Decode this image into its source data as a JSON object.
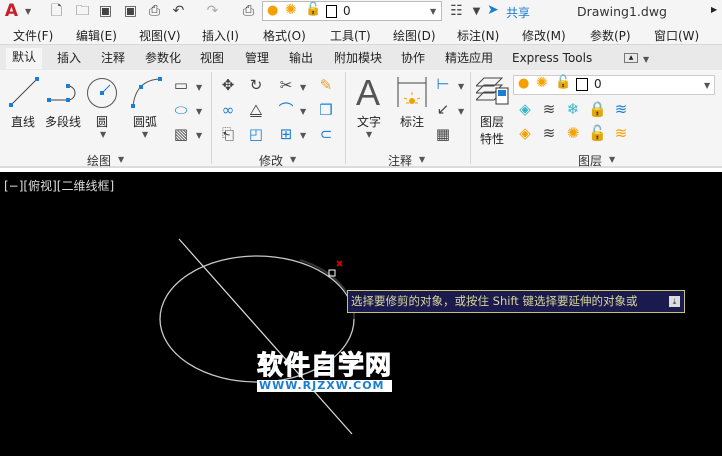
{
  "qat": {
    "app_icon": "A",
    "layer_value": "0",
    "share": "共享",
    "title": "Drawing1.dwg"
  },
  "menus": [
    "文件(F)",
    "编辑(E)",
    "视图(V)",
    "插入(I)",
    "格式(O)",
    "工具(T)",
    "绘图(D)",
    "标注(N)",
    "修改(M)",
    "参数(P)",
    "窗口(W)"
  ],
  "tabs": [
    "默认",
    "插入",
    "注释",
    "参数化",
    "视图",
    "管理",
    "输出",
    "附加模块",
    "协作",
    "精选应用",
    "Express Tools"
  ],
  "ribbon": {
    "draw": {
      "line": "直线",
      "polyline": "多段线",
      "circle": "圆",
      "arc": "圆弧",
      "panel": "绘图"
    },
    "modify": {
      "panel": "修改"
    },
    "annotation": {
      "text": "文字",
      "dimension": "标注",
      "panel": "注释"
    },
    "layers": {
      "properties_line1": "图层",
      "properties_line2": "特性",
      "current_layer": "0",
      "panel": "图层"
    }
  },
  "viewport": {
    "label": "[−][俯视][二维线框]"
  },
  "tooltip": {
    "text": "选择要修剪的对象，或按住 Shift 键选择要延伸的对象或"
  },
  "watermark": {
    "title": "软件自学网",
    "url": "WWW.RJZXW.COM"
  },
  "colors": {
    "accent": "#1a7fd4",
    "tooltip_bg": "#1a1a4e",
    "tooltip_border": "#c8c46a",
    "pickbox_red": "#e00000"
  }
}
